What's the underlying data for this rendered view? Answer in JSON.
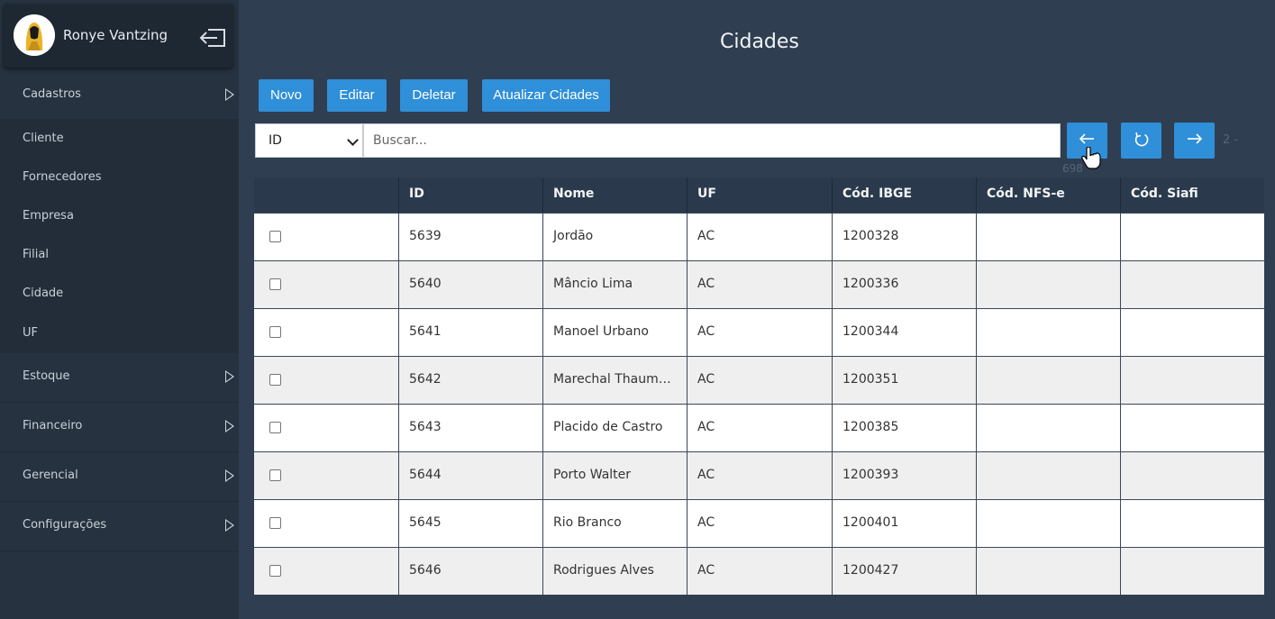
{
  "user": {
    "name": "Ronye Vantzing"
  },
  "sidebar": {
    "sections": [
      {
        "label": "Cadastros"
      },
      {
        "label": "Estoque"
      },
      {
        "label": "Financeiro"
      },
      {
        "label": "Gerencial"
      },
      {
        "label": "Configurações"
      }
    ],
    "cadastros_items": [
      {
        "label": "Cliente"
      },
      {
        "label": "Fornecedores"
      },
      {
        "label": "Empresa"
      },
      {
        "label": "Filial"
      },
      {
        "label": "Cidade"
      },
      {
        "label": "UF"
      }
    ]
  },
  "page": {
    "title": "Cidades"
  },
  "toolbar": {
    "novo": "Novo",
    "editar": "Editar",
    "deletar": "Deletar",
    "atualizar": "Atualizar Cidades"
  },
  "search": {
    "field_selected": "ID",
    "placeholder": "Buscar...",
    "page_info": "2 -",
    "total": "698"
  },
  "table": {
    "headers": [
      "",
      "ID",
      "Nome",
      "UF",
      "Cód. IBGE",
      "Cód. NFS-e",
      "Cód. Siafi"
    ],
    "rows": [
      {
        "id": "5639",
        "nome": "Jordão",
        "uf": "AC",
        "ibge": "1200328",
        "nfse": "",
        "siafi": ""
      },
      {
        "id": "5640",
        "nome": "Mâncio Lima",
        "uf": "AC",
        "ibge": "1200336",
        "nfse": "",
        "siafi": ""
      },
      {
        "id": "5641",
        "nome": "Manoel Urbano",
        "uf": "AC",
        "ibge": "1200344",
        "nfse": "",
        "siafi": ""
      },
      {
        "id": "5642",
        "nome": "Marechal Thaum…",
        "uf": "AC",
        "ibge": "1200351",
        "nfse": "",
        "siafi": ""
      },
      {
        "id": "5643",
        "nome": "Placido de Castro",
        "uf": "AC",
        "ibge": "1200385",
        "nfse": "",
        "siafi": ""
      },
      {
        "id": "5644",
        "nome": "Porto Walter",
        "uf": "AC",
        "ibge": "1200393",
        "nfse": "",
        "siafi": ""
      },
      {
        "id": "5645",
        "nome": "Rio Branco",
        "uf": "AC",
        "ibge": "1200401",
        "nfse": "",
        "siafi": ""
      },
      {
        "id": "5646",
        "nome": "Rodrigues Alves",
        "uf": "AC",
        "ibge": "1200427",
        "nfse": "",
        "siafi": ""
      }
    ]
  },
  "colors": {
    "primary": "#2f8fd8",
    "background": "#2f3e51",
    "sidebar": "#26323f"
  }
}
